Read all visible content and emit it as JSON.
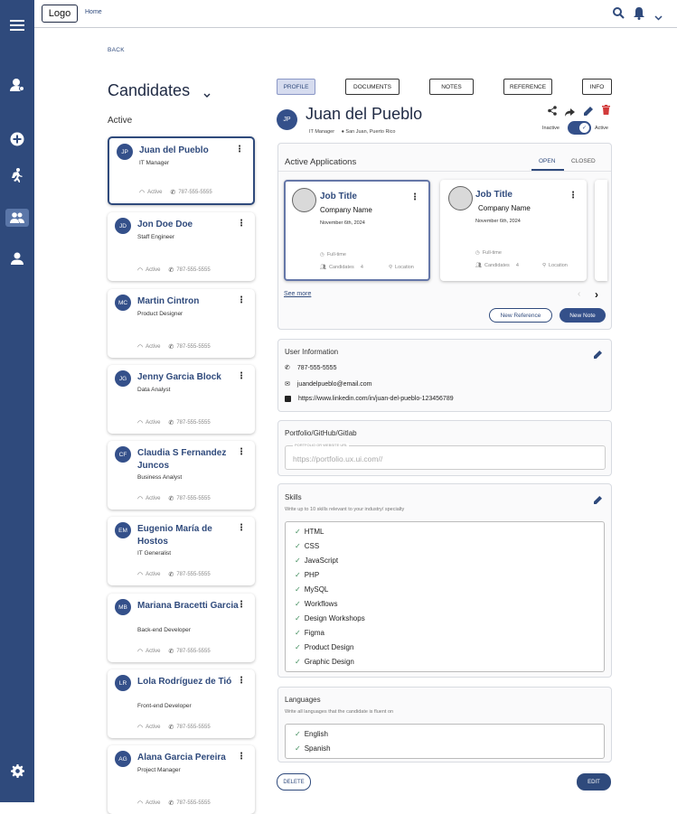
{
  "topbar": {
    "logo": "Logo",
    "breadcrumb": "Home"
  },
  "back": "BACK",
  "candidates": {
    "title": "Candidates",
    "section": "Active",
    "items": [
      {
        "initials": "JP",
        "name": "Juan del Pueblo",
        "role": "IT Manager",
        "status": "Active",
        "phone": "787-555-5555"
      },
      {
        "initials": "JD",
        "name": "Jon Doe Doe",
        "role": "Staff Engineer",
        "status": "Active",
        "phone": "787-555-5555"
      },
      {
        "initials": "MC",
        "name": "Martin Cintron",
        "role": "Product Designer",
        "status": "Active",
        "phone": "787-555-5555"
      },
      {
        "initials": "JG",
        "name": "Jenny Garcia Block",
        "role": "Data Analyst",
        "status": "Active",
        "phone": "787-555-5555"
      },
      {
        "initials": "CF",
        "name": "Claudia S Fernandez Juncos",
        "role": "Business Analyst",
        "status": "Active",
        "phone": "787-555-5555"
      },
      {
        "initials": "EM",
        "name": "Eugenio María de Hostos",
        "role": "IT Generalist",
        "status": "Active",
        "phone": "787-555-5555"
      },
      {
        "initials": "MB",
        "name": "Mariana Bracetti Garcia",
        "role": "Back-end Developer",
        "status": "Active",
        "phone": "787-555-5555"
      },
      {
        "initials": "LR",
        "name": "Lola Rodríguez de Tió",
        "role": "Front-end Developer",
        "status": "Active",
        "phone": "787-555-5555"
      },
      {
        "initials": "AG",
        "name": "Alana Garcia Pereira",
        "role": "Project Manager",
        "status": "Active",
        "phone": "787-555-5555"
      }
    ]
  },
  "tabs": [
    "PROFILE",
    "DOCUMENTS",
    "NOTES",
    "REFERENCE",
    "INFO"
  ],
  "profile": {
    "initials": "JP",
    "name": "Juan del Pueblo",
    "role": "IT Manager",
    "location": "San Juan, Puerto Rico",
    "toggle_off": "Inactive",
    "toggle_on": "Active"
  },
  "applications": {
    "title": "Active Applications",
    "tab_open": "OPEN",
    "tab_closed": "CLOSED",
    "jobs": [
      {
        "title": "Job Title",
        "company": "Company Name",
        "date": "November 6th, 2024",
        "type": "Full-time",
        "candidates_label": "Candidates",
        "candidates": "4",
        "location": "Location"
      },
      {
        "title": "Job Title",
        "company": "Company Name",
        "date": "November 6th, 2024",
        "type": "Full-time",
        "candidates_label": "Candidates",
        "candidates": "4",
        "location": "Location"
      }
    ],
    "see_more": "See more",
    "new_reference": "New Reference",
    "new_note": "New Note"
  },
  "user_info": {
    "title": "User Information",
    "phone": "787-555-5555",
    "email": "juandelpueblo@email.com",
    "linkedin": "https://www.linkedin.com/in/juan-del-pueblo-123456789"
  },
  "portfolio": {
    "title": "Portfolio/GitHub/Gitlab",
    "field_label": "PORTFOLIO OR WEBSITE URL",
    "placeholder": "https://portfolio.ux.ui.com//"
  },
  "skills": {
    "title": "Skills",
    "helper": "Write up to 10 skills relevant to your industry/ specialty",
    "items": [
      "HTML",
      "CSS",
      "JavaScript",
      "PHP",
      "MySQL",
      "Workflows",
      "Design Workshops",
      "Figma",
      "Product Design",
      "Graphic Design"
    ]
  },
  "languages": {
    "title": "Languages",
    "helper": "Write all languages that the candidate is fluent on",
    "items": [
      "English",
      "Spanish"
    ]
  },
  "actions": {
    "delete": "DELETE",
    "edit": "EDIT"
  },
  "colors": {
    "sidebar": "#2f4a7c",
    "accent": "#34508a",
    "danger": "#d23a3a"
  }
}
